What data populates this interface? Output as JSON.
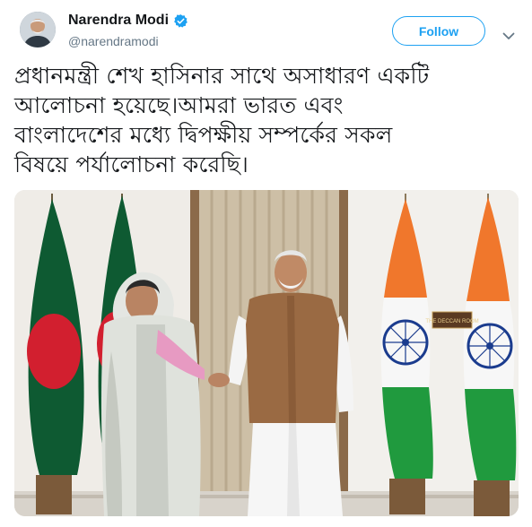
{
  "tweet": {
    "display_name": "Narendra Modi",
    "handle": "@narendramodi",
    "verified": true,
    "follow_label": "Follow",
    "text_lines": [
      "প্রধানমন্ত্রী শেখ হাসিনার সাথে অসাধারণ একটি",
      "আলোচনা হয়েছে।আমরা ভারত এবং",
      "বাংলাদেশের মধ্যে দ্বিপক্ষীয় সম্পর্কের সকল",
      "বিষয়ে পর্যালোচনা করেছি।"
    ],
    "photo_sign_text": "THE DECCAN ROOM"
  },
  "colors": {
    "accent": "#1da1f2",
    "handle_gray": "#657786",
    "text": "#14171a"
  },
  "icons": {
    "verified": "verified-badge-icon",
    "caret": "chevron-down-icon"
  }
}
